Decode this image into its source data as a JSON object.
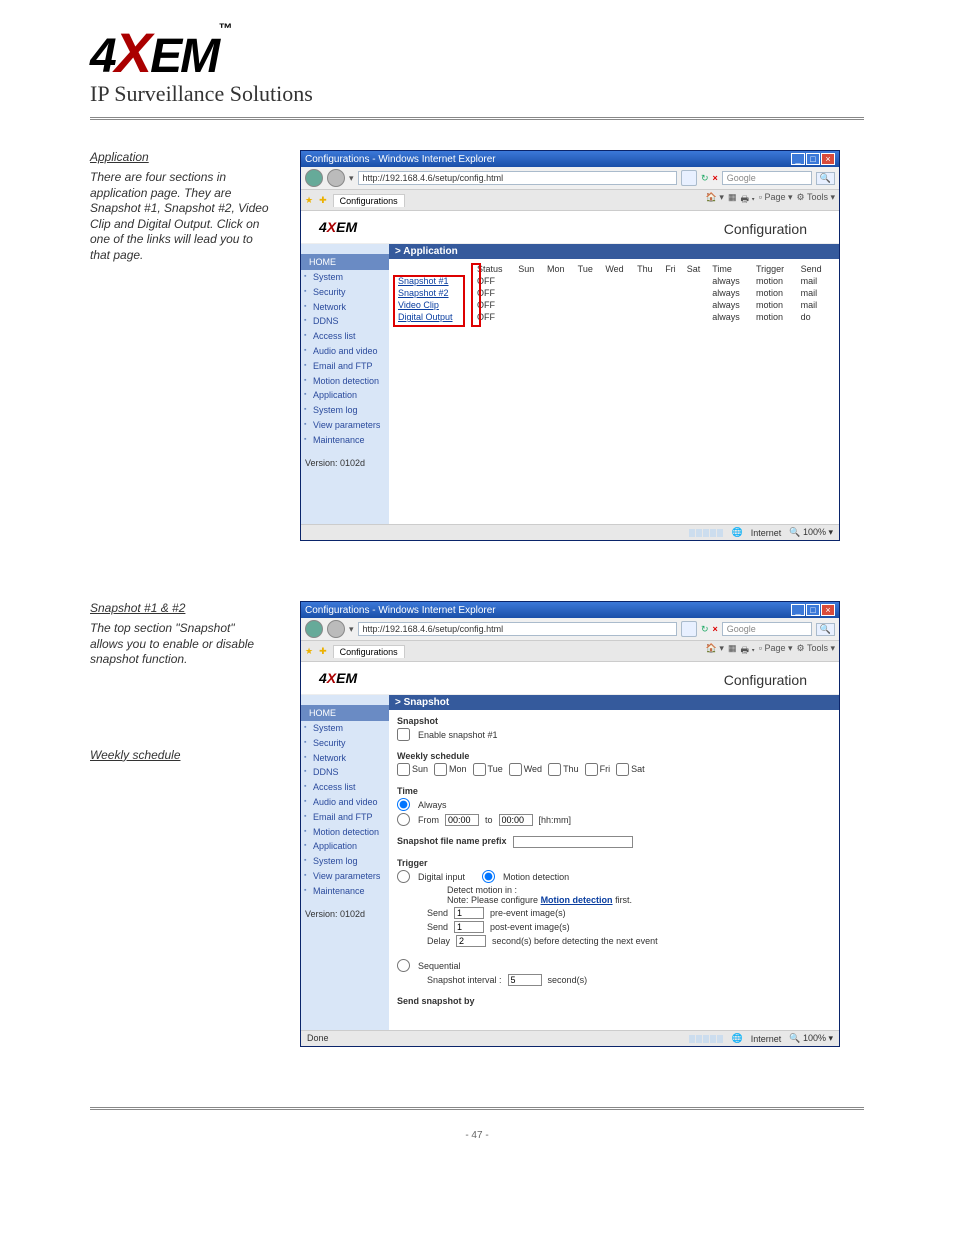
{
  "header": {
    "logo_main": "4",
    "logo_x": "X",
    "logo_suffix": "EM",
    "logo_tm": "™",
    "subtitle": "IP Surveillance Solutions"
  },
  "section1": {
    "heading": "Application",
    "paragraph": "There are four sections in application page. They are Snapshot #1, Snapshot #2, Video Clip and Digital Output. Click on one of the links will lead you to that page.",
    "screenshot": {
      "window_title": "Configurations - Windows Internet Explorer",
      "url": "http://192.168.4.6/setup/config.html",
      "search_placeholder": "Google",
      "tab_label": "Configurations",
      "toolbar_page": "Page",
      "toolbar_tools": "Tools",
      "logo_small": "4XEM",
      "config_title": "Configuration",
      "nav_home": "HOME",
      "nav_items": [
        "System",
        "Security",
        "Network",
        "DDNS",
        "Access list",
        "Audio and video",
        "Email and FTP",
        "Motion detection",
        "Application",
        "System log",
        "View parameters",
        "Maintenance"
      ],
      "version": "Version: 0102d",
      "panel_title": "> Application",
      "table": {
        "headers": [
          "",
          "Status",
          "Sun",
          "Mon",
          "Tue",
          "Wed",
          "Thu",
          "Fri",
          "Sat",
          "Time",
          "Trigger",
          "Send"
        ],
        "rows": [
          {
            "name": "Snapshot #1",
            "status": "OFF",
            "time": "always",
            "trigger": "motion",
            "send": "mail"
          },
          {
            "name": "Snapshot #2",
            "status": "OFF",
            "time": "always",
            "trigger": "motion",
            "send": "mail"
          },
          {
            "name": "Video Clip",
            "status": "OFF",
            "time": "always",
            "trigger": "motion",
            "send": "mail"
          },
          {
            "name": "Digital Output",
            "status": "OFF",
            "time": "always",
            "trigger": "motion",
            "send": "do"
          }
        ]
      },
      "status_done": "",
      "status_zone": "Internet",
      "status_zoom": "100%"
    }
  },
  "section2": {
    "heading": "Snapshot #1 & #2",
    "para1": "The top section \"Snapshot\" allows you to enable or disable snapshot function.",
    "subheading": "Weekly schedule",
    "screenshot": {
      "window_title": "Configurations - Windows Internet Explorer",
      "url": "http://192.168.4.6/setup/config.html",
      "search_placeholder": "Google",
      "tab_label": "Configurations",
      "toolbar_page": "Page",
      "toolbar_tools": "Tools",
      "config_title": "Configuration",
      "nav_home": "HOME",
      "nav_items": [
        "System",
        "Security",
        "Network",
        "DDNS",
        "Access list",
        "Audio and video",
        "Email and FTP",
        "Motion detection",
        "Application",
        "System log",
        "View parameters",
        "Maintenance"
      ],
      "version": "Version: 0102d",
      "panel_title": "> Snapshot",
      "snapshot_title": "Snapshot",
      "enable_label": "Enable snapshot #1",
      "weekly_title": "Weekly schedule",
      "days": [
        "Sun",
        "Mon",
        "Tue",
        "Wed",
        "Thu",
        "Fri",
        "Sat"
      ],
      "time_title": "Time",
      "always_label": "Always",
      "from_label": "From",
      "to_label": "to",
      "from_value": "00:00",
      "to_value": "00:00",
      "hhmm": "[hh:mm]",
      "prefix_title": "Snapshot file name prefix",
      "trigger_title": "Trigger",
      "digital_input_label": "Digital input",
      "motion_label": "Motion detection",
      "detect_label": "Detect motion in :",
      "note_prefix": "Note: Please configure ",
      "note_link": "Motion detection",
      "note_suffix": " first.",
      "send_label": "Send",
      "pre_event": "pre-event image(s)",
      "post_event": "post-event image(s)",
      "delay_label": "Delay",
      "delay_value": "2",
      "delay_suffix": "second(s) before detecting the next event",
      "send_value": "1",
      "sequential_label": "Sequential",
      "interval_label": "Snapshot interval :",
      "interval_value": "5",
      "seconds_label": "second(s)",
      "send_by_title": "Send snapshot by",
      "status_done": "Done",
      "status_zone": "Internet",
      "status_zoom": "100%"
    }
  },
  "page_number": "- 47 -"
}
